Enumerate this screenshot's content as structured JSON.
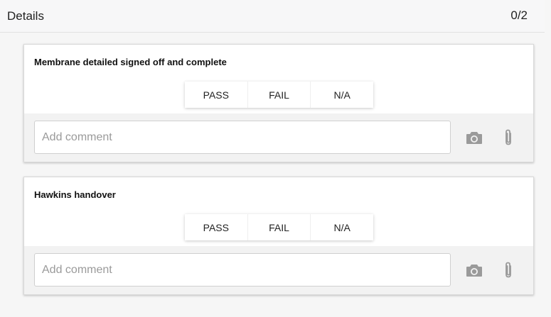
{
  "header": {
    "title": "Details",
    "count": "0/2"
  },
  "items": [
    {
      "title": "Membrane detailed signed off and complete",
      "options": [
        "PASS",
        "FAIL",
        "N/A"
      ],
      "comment": {
        "placeholder": "Add comment",
        "value": ""
      }
    },
    {
      "title": "Hawkins handover",
      "options": [
        "PASS",
        "FAIL",
        "N/A"
      ],
      "comment": {
        "placeholder": "Add comment",
        "value": ""
      }
    }
  ],
  "icons": {
    "camera": "camera-icon",
    "attach": "paperclip-icon"
  },
  "colors": {
    "icon": "#9a9a9a",
    "footer_bg": "#f2f2f2",
    "header_bg": "#f7f7f8"
  }
}
